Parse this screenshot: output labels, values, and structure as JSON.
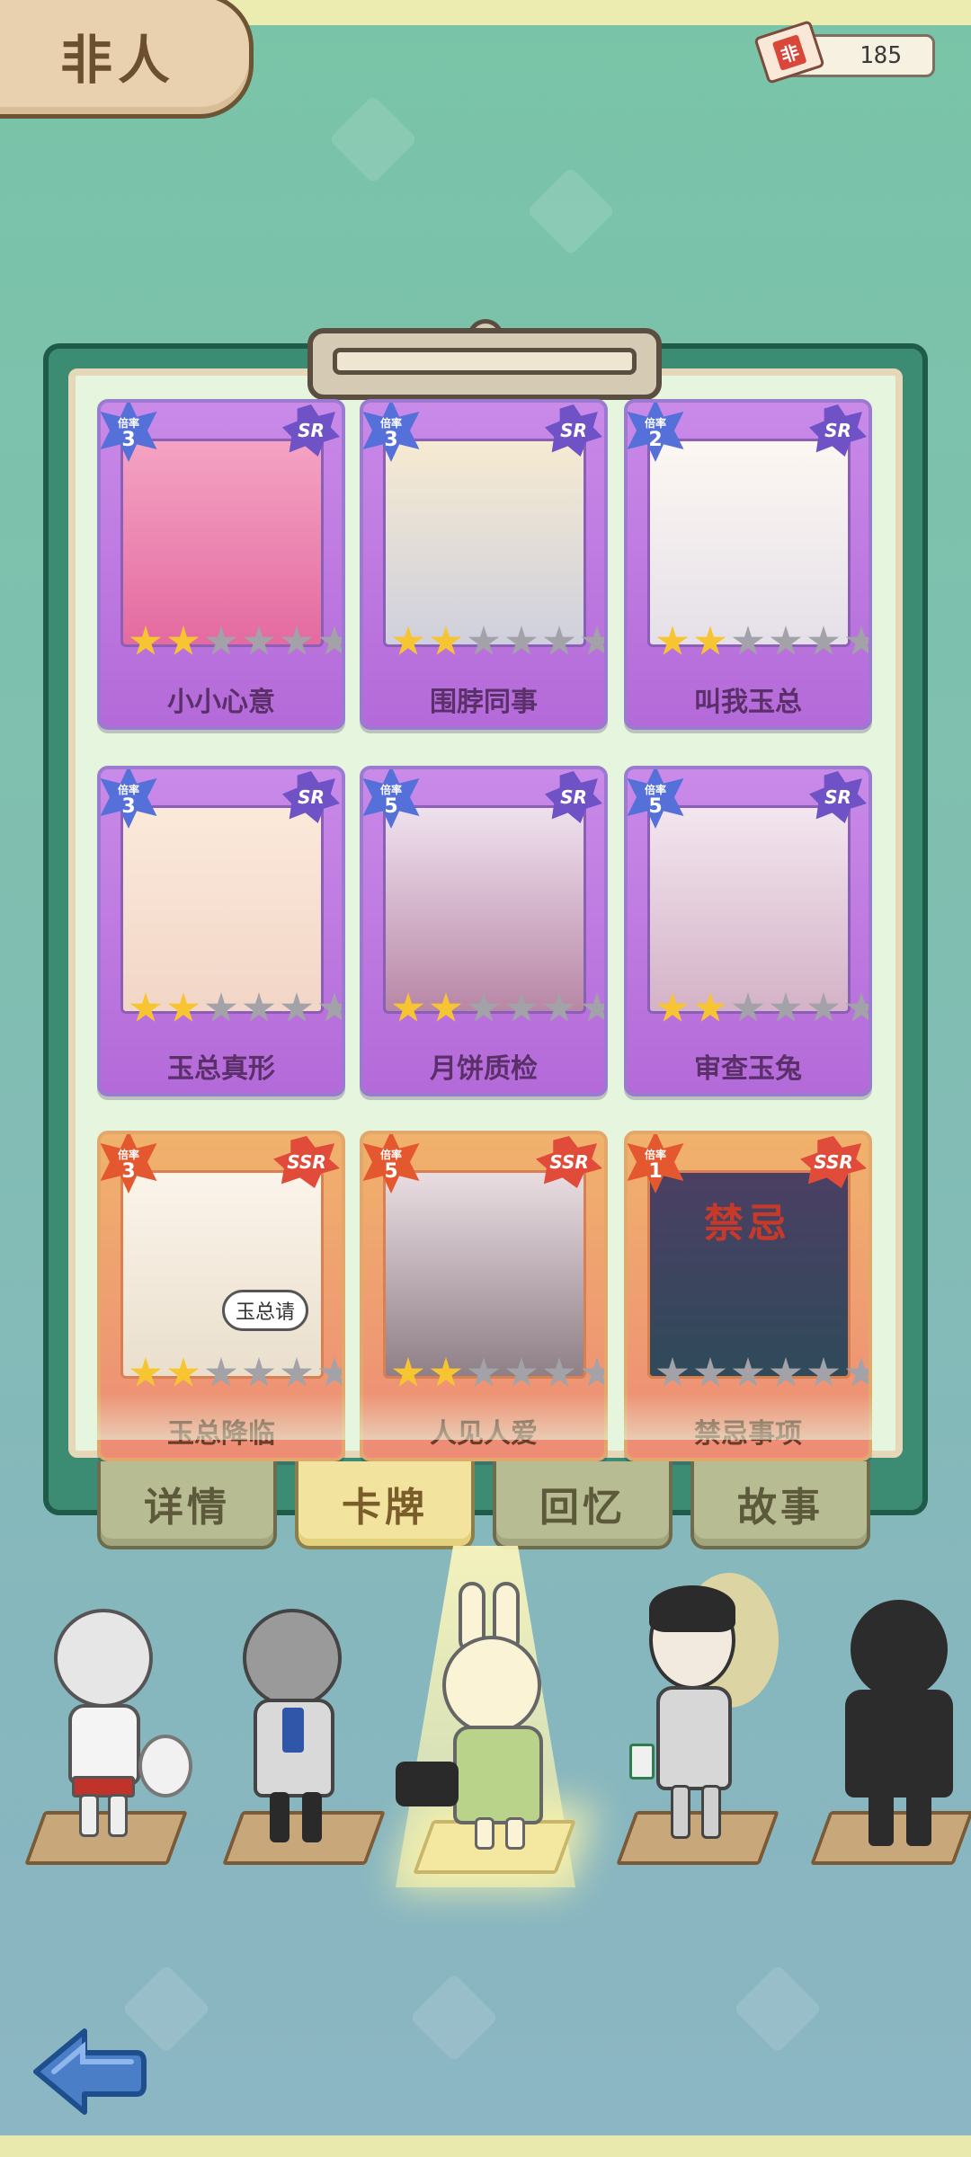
{
  "header": {
    "title": "非人",
    "currency_icon_text": "非",
    "currency_value": "185"
  },
  "cards": [
    {
      "name": "小小心意",
      "rarity": "SR",
      "rate_label": "倍率",
      "rate": "3",
      "stars_filled": 2,
      "stars_total": 6
    },
    {
      "name": "围脖同事",
      "rarity": "SR",
      "rate_label": "倍率",
      "rate": "3",
      "stars_filled": 2,
      "stars_total": 6
    },
    {
      "name": "叫我玉总",
      "rarity": "SR",
      "rate_label": "倍率",
      "rate": "2",
      "stars_filled": 2,
      "stars_total": 6
    },
    {
      "name": "玉总真形",
      "rarity": "SR",
      "rate_label": "倍率",
      "rate": "3",
      "stars_filled": 2,
      "stars_total": 6
    },
    {
      "name": "月饼质检",
      "rarity": "SR",
      "rate_label": "倍率",
      "rate": "5",
      "stars_filled": 2,
      "stars_total": 6
    },
    {
      "name": "审查玉兔",
      "rarity": "SR",
      "rate_label": "倍率",
      "rate": "5",
      "stars_filled": 2,
      "stars_total": 6
    },
    {
      "name": "玉总降临",
      "rarity": "SSR",
      "rate_label": "倍率",
      "rate": "3",
      "stars_filled": 2,
      "stars_total": 6,
      "art_text": "玉总请"
    },
    {
      "name": "人见人爱",
      "rarity": "SSR",
      "rate_label": "倍率",
      "rate": "5",
      "stars_filled": 2,
      "stars_total": 6
    },
    {
      "name": "禁忌事项",
      "rarity": "SSR",
      "rate_label": "倍率",
      "rate": "1",
      "stars_filled": 0,
      "stars_total": 6,
      "art_text": "禁忌"
    }
  ],
  "tabs": [
    {
      "label": "详情",
      "active": false
    },
    {
      "label": "卡牌",
      "active": true
    },
    {
      "label": "回忆",
      "active": false
    },
    {
      "label": "故事",
      "active": false
    }
  ],
  "characters": [
    {
      "name": "white-fox-character",
      "selected": false,
      "locked": false
    },
    {
      "name": "deer-character",
      "selected": false,
      "locked": false
    },
    {
      "name": "rabbit-character",
      "selected": true,
      "locked": false
    },
    {
      "name": "man-coffee-character",
      "selected": false,
      "locked": false
    },
    {
      "name": "silhouette-character",
      "selected": false,
      "locked": true
    }
  ],
  "icons": {
    "back": "back-arrow-icon",
    "ticket": "ticket-icon",
    "star": "star-icon"
  },
  "colors": {
    "sr_card": "#b46ad9",
    "ssr_card": "#ee8c76",
    "board": "#3b8c72",
    "active_tab": "#f2e49e",
    "star_on": "#f7c531",
    "star_off": "#a2a2a8"
  }
}
